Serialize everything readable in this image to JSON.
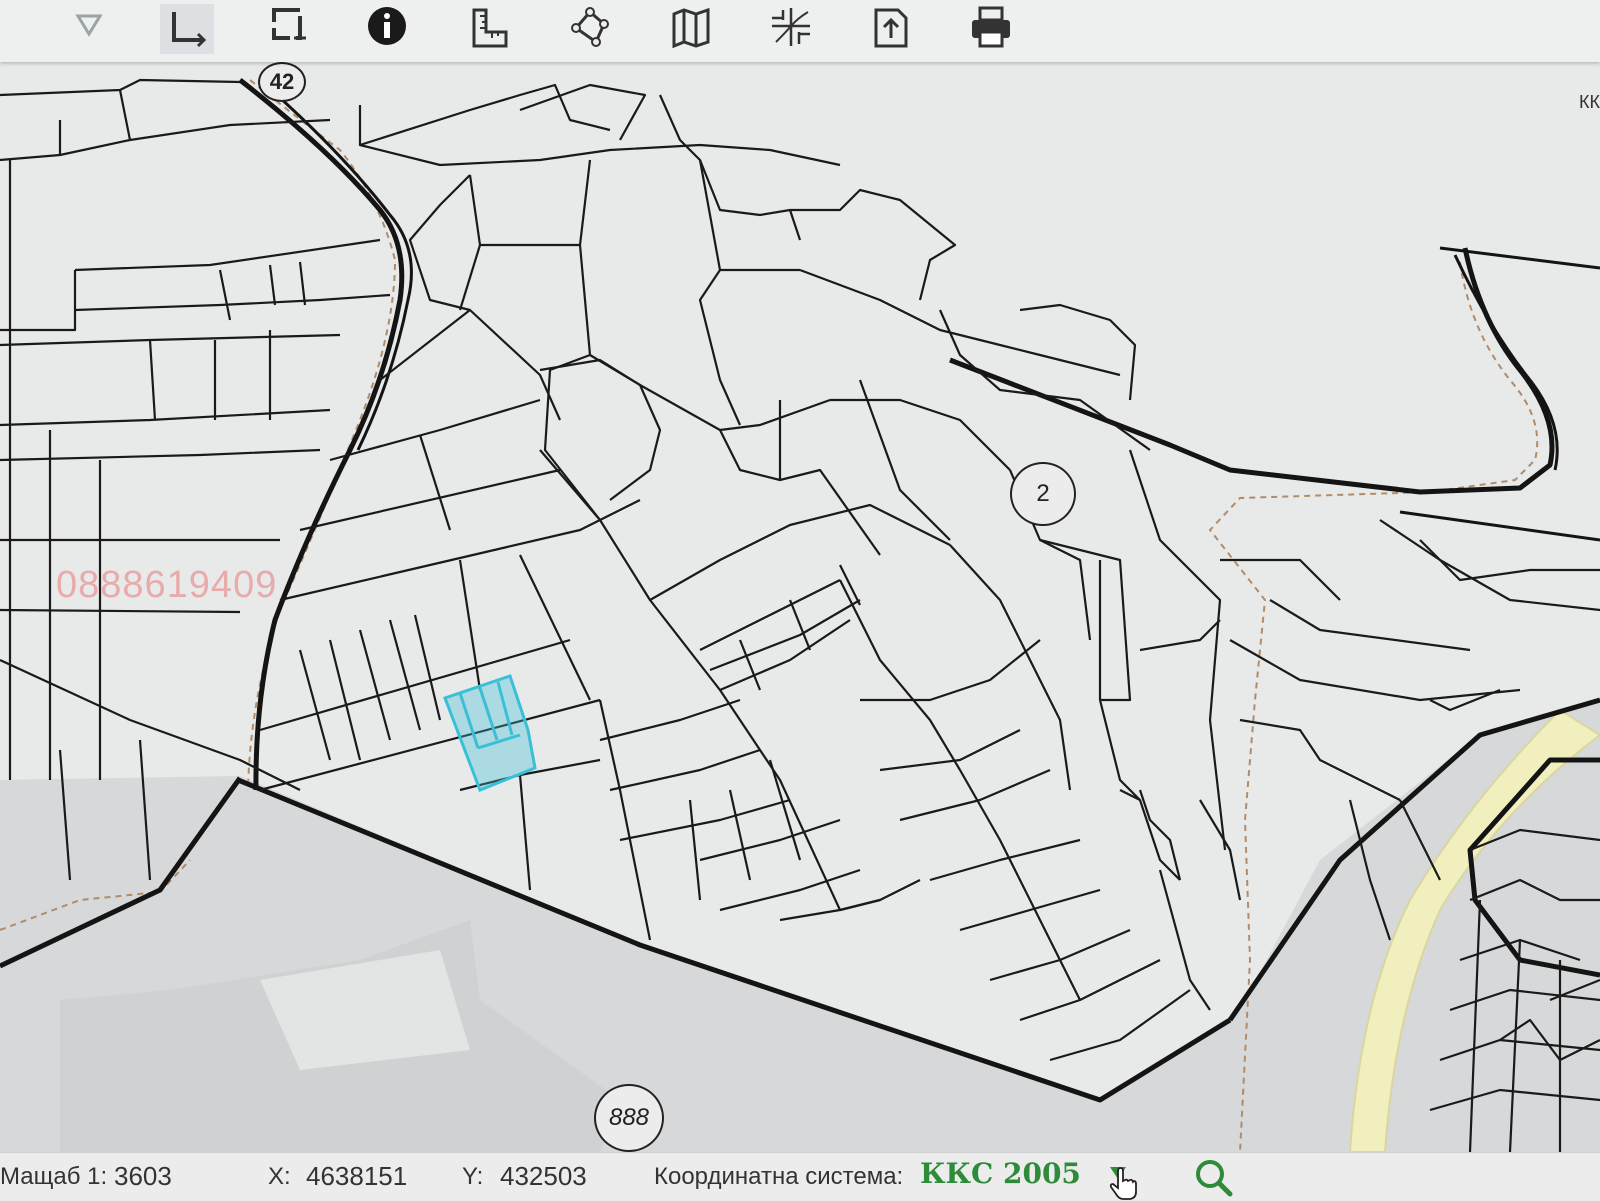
{
  "toolbar": {
    "tools": [
      {
        "name": "select",
        "icon": "select-arrow-icon"
      },
      {
        "name": "draw-rectangle",
        "icon": "draw-rectangle-icon"
      },
      {
        "name": "clear-selection",
        "icon": "clear-selection-icon"
      },
      {
        "name": "info",
        "icon": "info-icon"
      },
      {
        "name": "measure",
        "icon": "ruler-icon"
      },
      {
        "name": "measure-area",
        "icon": "polygon-icon"
      },
      {
        "name": "layers",
        "icon": "map-icon"
      },
      {
        "name": "coordinates",
        "icon": "crosshair-grid-icon"
      },
      {
        "name": "export",
        "icon": "export-document-icon"
      },
      {
        "name": "print",
        "icon": "printer-icon"
      }
    ]
  },
  "map": {
    "corner_label": "КК",
    "watermark": "0888619409",
    "road_badges": [
      "42",
      "2",
      "888"
    ],
    "highlight_color": "#39c0d6",
    "line_color": "#1a1a1a",
    "road_fill_color": "#f1efbe"
  },
  "statusbar": {
    "scale_label": "Мащаб 1:",
    "scale_value": "3603",
    "x_label": "X:",
    "x_value": "4638151",
    "y_label": "Y:",
    "y_value": "432503",
    "crs_label": "Координатна система:",
    "crs_value": "ККС 2005",
    "accent_color": "#2e8b3a"
  }
}
